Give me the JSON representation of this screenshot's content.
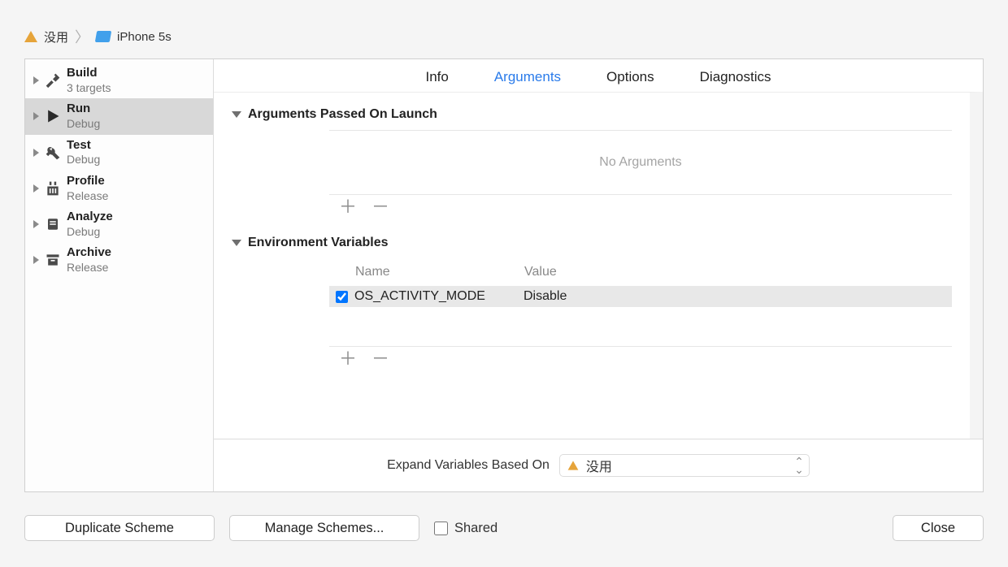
{
  "breadcrumb": {
    "scheme_name": "没用",
    "destination": "iPhone 5s"
  },
  "sidebar": {
    "items": [
      {
        "title": "Build",
        "subtitle": "3 targets",
        "icon": "hammer-icon"
      },
      {
        "title": "Run",
        "subtitle": "Debug",
        "icon": "play-icon"
      },
      {
        "title": "Test",
        "subtitle": "Debug",
        "icon": "wrench-icon"
      },
      {
        "title": "Profile",
        "subtitle": "Release",
        "icon": "gauge-icon"
      },
      {
        "title": "Analyze",
        "subtitle": "Debug",
        "icon": "analyze-icon"
      },
      {
        "title": "Archive",
        "subtitle": "Release",
        "icon": "archive-icon"
      }
    ],
    "selected_index": 1
  },
  "tabs": {
    "items": [
      "Info",
      "Arguments",
      "Options",
      "Diagnostics"
    ],
    "active_index": 1
  },
  "sections": {
    "arguments": {
      "title": "Arguments Passed On Launch",
      "empty_text": "No Arguments"
    },
    "env": {
      "title": "Environment Variables",
      "columns": {
        "name": "Name",
        "value": "Value"
      },
      "rows": [
        {
          "enabled": true,
          "name": "OS_ACTIVITY_MODE",
          "value": "Disable"
        }
      ]
    }
  },
  "expand": {
    "label": "Expand Variables Based On",
    "selected": "没用"
  },
  "buttons": {
    "duplicate": "Duplicate Scheme",
    "manage": "Manage Schemes...",
    "shared": "Shared",
    "close": "Close"
  }
}
